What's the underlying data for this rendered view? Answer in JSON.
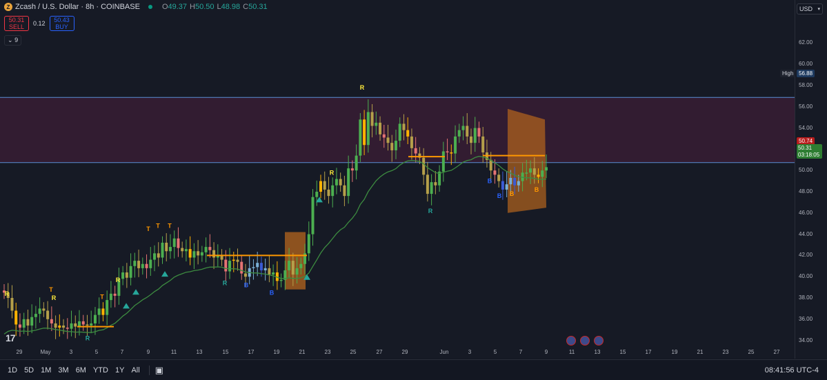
{
  "header": {
    "symbol": "Zcash / U.S. Dollar · 8h · COINBASE",
    "open_key": "O",
    "open": "49.37",
    "high_key": "H",
    "high": "50.50",
    "low_key": "L",
    "low": "48.98",
    "close_key": "C",
    "close": "50.31"
  },
  "trade": {
    "sell_price": "50.31",
    "sell_label": "SELL",
    "spread": "0.12",
    "buy_price": "50.43",
    "buy_label": "BUY"
  },
  "indicators_count": "9",
  "currency": "USD",
  "price_axis": [
    "62.00",
    "60.00",
    "58.00",
    "56.00",
    "54.00",
    "52.00",
    "50.00",
    "48.00",
    "46.00",
    "44.00",
    "42.00",
    "40.00",
    "38.00",
    "36.00",
    "34.00"
  ],
  "tags": {
    "high_label": "High",
    "high_value": "56.88",
    "ref_value": "50.74",
    "last_value": "50.31",
    "countdown": "03:18:05"
  },
  "time_axis": [
    "29",
    "May",
    "3",
    "5",
    "7",
    "9",
    "11",
    "13",
    "15",
    "17",
    "19",
    "21",
    "23",
    "25",
    "27",
    "29",
    "Jun",
    "3",
    "5",
    "7",
    "9",
    "11",
    "13",
    "15",
    "17",
    "19",
    "21",
    "23",
    "25",
    "27"
  ],
  "bottom_bar": {
    "ranges": [
      "1D",
      "5D",
      "1M",
      "3M",
      "6M",
      "YTD",
      "1Y",
      "All"
    ],
    "clock": "08:41:56 UTC-4"
  },
  "chart_data": {
    "type": "candlestick",
    "interval": "8h",
    "x_start": "2025-04-29",
    "x_end": "2025-06-09",
    "ylim": [
      33,
      63
    ],
    "close": [
      38.5,
      38.0,
      36.8,
      35.5,
      35.2,
      36.0,
      35.4,
      36.2,
      36.5,
      37.0,
      36.8,
      36.0,
      35.6,
      35.2,
      35.4,
      35.2,
      35.1,
      35.6,
      35.3,
      35.8,
      35.5,
      35.4,
      35.6,
      36.4,
      37.0,
      36.4,
      37.8,
      38.4,
      38.2,
      39.8,
      40.4,
      39.9,
      41.0,
      41.5,
      40.8,
      41.2,
      40.8,
      41.6,
      42.2,
      41.8,
      43.2,
      42.4,
      42.8,
      43.6,
      42.7,
      42.4,
      42.6,
      41.8,
      42.4,
      42.0,
      42.3,
      42.8,
      42.5,
      41.8,
      42.0,
      41.6,
      40.5,
      41.5,
      41.6,
      41.4,
      40.3,
      40.0,
      40.8,
      40.9,
      41.3,
      40.6,
      40.8,
      40.2,
      40.4,
      39.6,
      39.7,
      40.6,
      41.5,
      40.2,
      40.8,
      41.2,
      42.2,
      44.0,
      47.5,
      48.0,
      49.0,
      48.2,
      47.6,
      48.6,
      49.2,
      48.6,
      47.6,
      50.2,
      50.0,
      51.4,
      54.8,
      52.4,
      55.5,
      54.2,
      54.5,
      53.4,
      53.1,
      52.6,
      51.9,
      52.8,
      54.4,
      53.8,
      53.2,
      52.1,
      51.6,
      51.2,
      49.6,
      47.8,
      48.9,
      48.6,
      49.9,
      51.8,
      51.7,
      51.6,
      53.2,
      53.8,
      54.2,
      53.2,
      52.6,
      54.0,
      53.2,
      51.7,
      51.0,
      50.0,
      49.6,
      49.0,
      48.2,
      48.7,
      49.3,
      48.6,
      49.0,
      49.8,
      49.8,
      50.2,
      49.6,
      49.4,
      50.0,
      50.31
    ],
    "series": [
      {
        "name": "trend line",
        "color": "#4caf50"
      },
      {
        "name": "support/resistance",
        "color": "#ff9800"
      }
    ],
    "signals": [
      "R",
      "T",
      "B"
    ],
    "high_line": 56.88,
    "ref_line": 50.74
  }
}
